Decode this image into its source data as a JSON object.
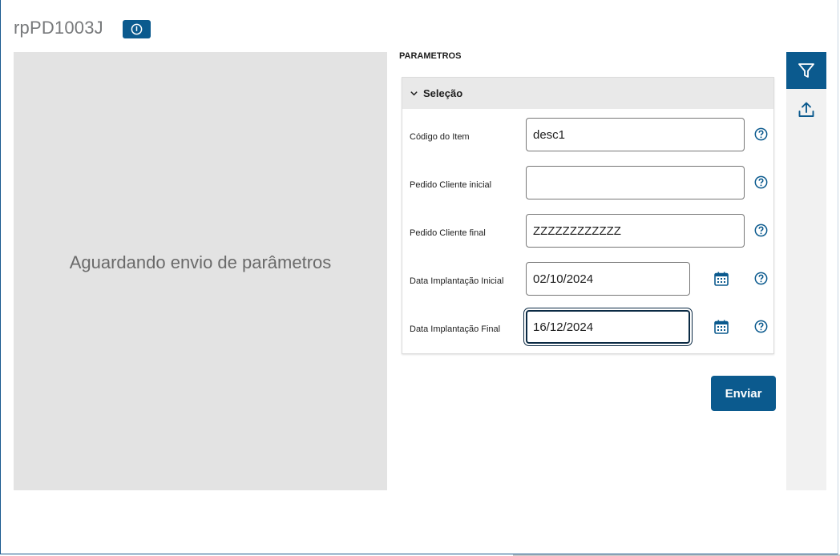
{
  "header": {
    "title": "rpPD1003J",
    "info_icon": "info-icon"
  },
  "preview": {
    "message": "Aguardando envio de parâmetros"
  },
  "params": {
    "heading": "PARAMETROS",
    "section_title": "Seleção",
    "fields": [
      {
        "label": "Código do Item",
        "value": "desc1",
        "has_calendar": false
      },
      {
        "label": "Pedido Cliente inicial",
        "value": "",
        "has_calendar": false
      },
      {
        "label": "Pedido Cliente final",
        "value": "ZZZZZZZZZZZZ",
        "has_calendar": false
      },
      {
        "label": "Data Implantação Inicial",
        "value": "02/10/2024",
        "has_calendar": true
      },
      {
        "label": "Data Implantação Final",
        "value": "16/12/2024",
        "has_calendar": true,
        "focused": true
      }
    ],
    "submit_label": "Enviar"
  },
  "sidebar": {
    "icons": [
      "filter-icon",
      "upload-icon"
    ]
  },
  "colors": {
    "accent": "#0b5a8e",
    "preview_bg": "#e3e3e3",
    "section_header_bg": "#e9e9e9"
  }
}
